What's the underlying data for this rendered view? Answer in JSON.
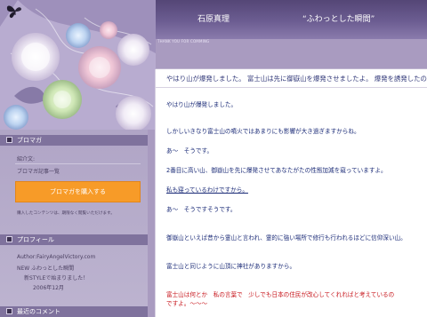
{
  "header": {
    "author": "石原真理",
    "blog_title": "“ふわっとした瞬間”",
    "tagline": "THANK YOU FOR COMMING"
  },
  "sidebar": {
    "section_magazine": "ブロマガ",
    "intro_label": "紹介文:",
    "magazine_list_link": "ブロマガ記事一覧",
    "buy_button": "ブロマガを購入する",
    "note": "購入したコンテンツは、期限なく閲覧いただけます。",
    "section_profile": "プロフィール",
    "profile_lines": [
      "Author:FairyAngelVictory.com",
      "NEW ふわっとした瞬間",
      "新STYLEで始まりました！",
      "2006年12月"
    ],
    "section_recent": "最近のコメント"
  },
  "entry": {
    "title": "やはり山が爆発しました。  富士山は先に御嶽山を爆発させましたよ。  爆発を誘発したのです。",
    "lines": [
      "やはり山が爆発しました。",
      "しかしいきなり富士山の噴火ではあまりにも影響が大き過ぎますからね。",
      "あ～　そうです。",
      "2番目に高い山、御嶽山を先に爆発させてあなたがたの性態加減を窺っていますよ。",
      "私も寝っているわけですから。",
      "あ～　そうですそうです。",
      "御嶽山といえば昔から霊山と言われ、霊的に強い場所で修行も行われるほどに信仰深い山。",
      "富士山と同じように山頂に神社がありますから。",
      "富士山は何とか　私の言葉で　少しでも日本の住民が改心してくれればと考えているの",
      "ですよ。～～～"
    ]
  }
}
